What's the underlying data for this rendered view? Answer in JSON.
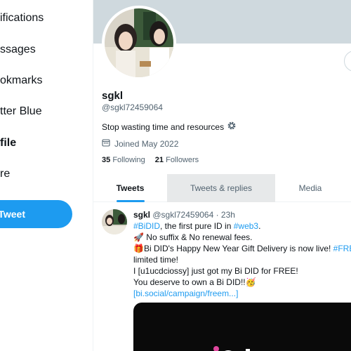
{
  "nav": {
    "items": [
      {
        "label": "ifications"
      },
      {
        "label": "ssages"
      },
      {
        "label": "okmarks"
      },
      {
        "label": "tter Blue"
      },
      {
        "label": "file"
      },
      {
        "label": "re"
      }
    ],
    "tweet_button": "Tweet"
  },
  "profile": {
    "name": "sgkl",
    "handle": "@sgkl72459064",
    "bio": "Stop wasting time and resources",
    "joined": "Joined May 2022",
    "following_count": "35",
    "following_label": "Following",
    "followers_count": "21",
    "followers_label": "Followers"
  },
  "tabs": [
    {
      "label": "Tweets"
    },
    {
      "label": "Tweets & replies"
    },
    {
      "label": "Media"
    }
  ],
  "tweet": {
    "name": "sgkl",
    "handle_time": "@sgkl72459064 · 23h",
    "l1_hashtag": "#BiDID",
    "l1_text": ", the first pure ID in ",
    "l1_hashtag2": "#web3",
    "l1_end": ".",
    "l2": "🚀 No suffix & No renewal fees.",
    "l3_text": "🎁Bi DID's Happy New Year Gift Delivery is now live! ",
    "l3_link": "#FREEM",
    "l4": "limited time!",
    "l5": "I [u1ucdciossy] just got my Bi DID for FREE!",
    "l6": "You deserve to own a Bi DID!!🥳",
    "l7_link": "[bi.social/campaign/freem...]"
  },
  "colors": {
    "accent": "#1d9bf0",
    "banner": "#cfd9de",
    "muted_text": "#536471"
  }
}
